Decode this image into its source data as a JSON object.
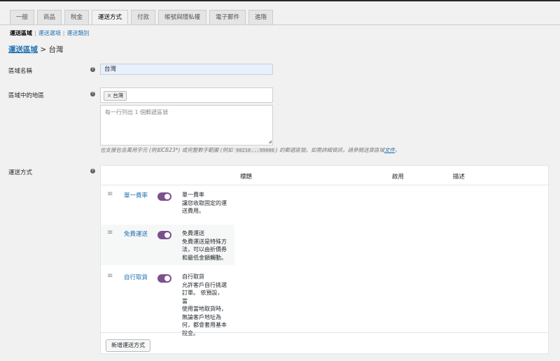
{
  "tabs": [
    "一般",
    "商品",
    "稅金",
    "運送方式",
    "付款",
    "帳號與隱私權",
    "電子郵件",
    "進階"
  ],
  "subnav": {
    "current": "運送區域",
    "items": [
      "運送選項",
      "運送類別"
    ]
  },
  "breadcrumb": {
    "link": "運送區域",
    "sep": " > ",
    "current": "台灣"
  },
  "zone_name": {
    "label": "區域名稱",
    "value": "台灣"
  },
  "regions": {
    "label": "區域中的地區",
    "chip": "台灣",
    "chip_remove": "×",
    "postcode_placeholder": "每一行列出 1 個郵遞區號"
  },
  "note": {
    "text1": "也支援包含萬用字元 (例如CB23*) 或完整數字範圍 (例如 ",
    "code": "90210...99000",
    "text2": ") 的郵遞區號。如需詳細資訊，請參閱送貨區域",
    "link": "文件",
    "text3": "。"
  },
  "methods": {
    "label": "運送方式",
    "headers": {
      "title": "標題",
      "enabled": "啟用",
      "description": "描述"
    },
    "rows": [
      {
        "name": "單一費率",
        "desc_title": "單一費率",
        "desc_lines": [
          "讓您收取固定的運",
          "送費用。"
        ]
      },
      {
        "name": "免費運送",
        "desc_title": "免費運送",
        "desc_lines": [
          "免費運送是特殊方",
          "法，可以由折價券",
          "和最低金額觸動。"
        ]
      },
      {
        "name": "自行取貨",
        "desc_title": "自行取貨",
        "desc_lines": [
          "允許客戶自行挑選",
          "訂單。 依預設，當",
          "使用當地取貨時，",
          "無論客戶地址為",
          "何，都會套用基本",
          "稅金。"
        ]
      }
    ],
    "add_button": "新增運送方式"
  },
  "colors": {
    "accent": "#2271b1",
    "toggle": "#7c4f8f"
  },
  "icons": {
    "help": "question-circle-icon",
    "drag": "drag-handle-icon",
    "remove": "close-icon"
  }
}
